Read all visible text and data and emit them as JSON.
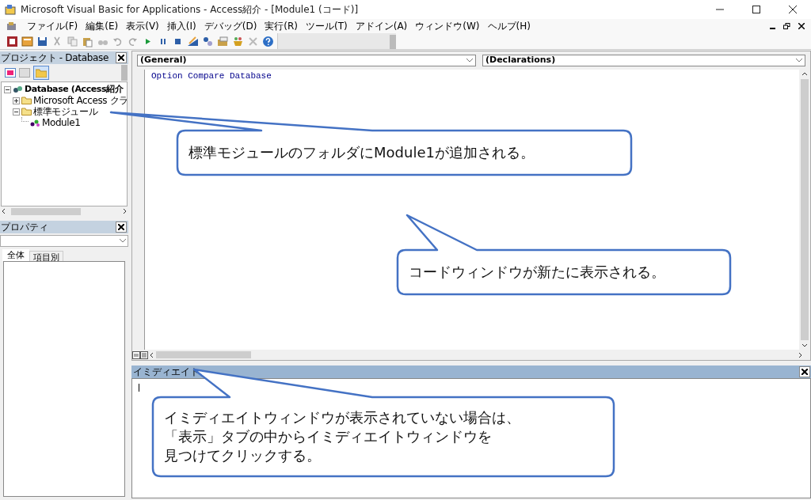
{
  "window": {
    "title": "Microsoft Visual Basic for Applications - Access紹介 - [Module1 (コード)]"
  },
  "menu": [
    "ファイル(F)",
    "編集(E)",
    "表示(V)",
    "挿入(I)",
    "デバッグ(D)",
    "実行(R)",
    "ツール(T)",
    "アドイン(A)",
    "ウィンドウ(W)",
    "ヘルプ(H)"
  ],
  "project_panel": {
    "title": "プロジェクト - Database",
    "tree": [
      {
        "label": "Database (Access紹介",
        "expanded": true,
        "children": [
          {
            "label": "Microsoft Access クラ",
            "expanded": false
          },
          {
            "label": "標準モジュール",
            "expanded": true,
            "children": [
              {
                "label": "Module1"
              }
            ]
          }
        ]
      }
    ]
  },
  "properties_panel": {
    "title": "プロパティ",
    "tabs": [
      {
        "label": "全体",
        "selected": true
      },
      {
        "label": "項目別",
        "selected": false
      }
    ]
  },
  "code_window": {
    "object_dropdown": "(General)",
    "procedure_dropdown": "(Declarations)",
    "lines": [
      "Option Compare Database"
    ]
  },
  "immediate_window": {
    "title": "イミディエイト"
  },
  "callouts": [
    {
      "lines": [
        "標準モジュールのフォルダにModule1が追加される。"
      ]
    },
    {
      "lines": [
        "コードウィンドウが新たに表示される。"
      ]
    },
    {
      "lines": [
        "イミディエイトウィンドウが表示されていない場合は、",
        "「表示」タブの中からイミディエイトウィンドウを",
        "見つけてクリックする。"
      ]
    }
  ]
}
